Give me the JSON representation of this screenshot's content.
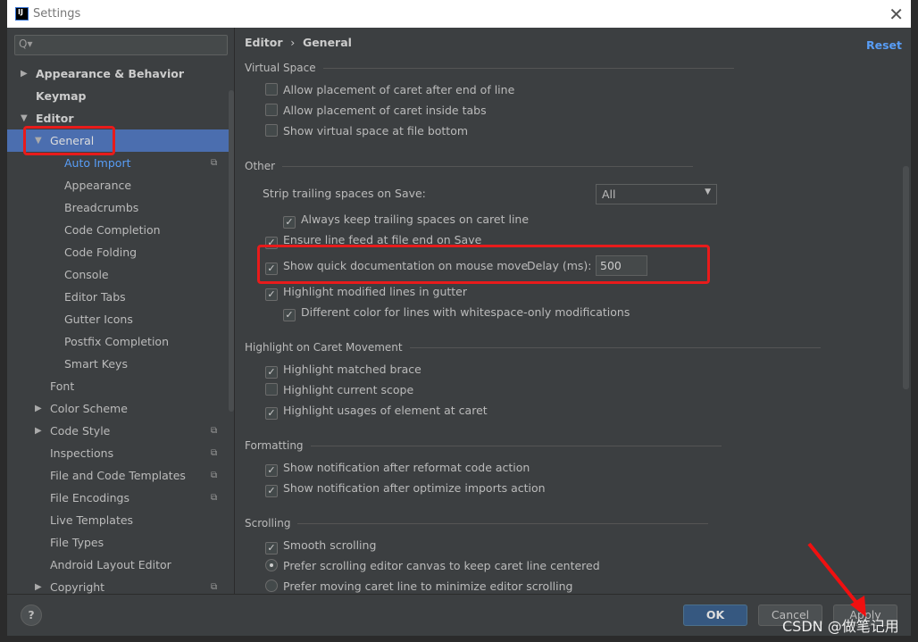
{
  "window": {
    "title": "Settings",
    "logo": "IJ",
    "close_icon": "close-icon"
  },
  "sidebar": {
    "search_placeholder": "Q▾",
    "items": [
      {
        "label": "Appearance & Behavior",
        "level": 0,
        "arrow": "▶",
        "bold": true
      },
      {
        "label": "Keymap",
        "level": 0,
        "arrow": "",
        "bold": true
      },
      {
        "label": "Editor",
        "level": 0,
        "arrow": "▼",
        "bold": true
      },
      {
        "label": "General",
        "level": 1,
        "arrow": "▼",
        "selected": true
      },
      {
        "label": "Auto Import",
        "level": 2,
        "blue": true,
        "copy": true
      },
      {
        "label": "Appearance",
        "level": 2
      },
      {
        "label": "Breadcrumbs",
        "level": 2
      },
      {
        "label": "Code Completion",
        "level": 2
      },
      {
        "label": "Code Folding",
        "level": 2
      },
      {
        "label": "Console",
        "level": 2
      },
      {
        "label": "Editor Tabs",
        "level": 2
      },
      {
        "label": "Gutter Icons",
        "level": 2
      },
      {
        "label": "Postfix Completion",
        "level": 2
      },
      {
        "label": "Smart Keys",
        "level": 2
      },
      {
        "label": "Font",
        "level": 1
      },
      {
        "label": "Color Scheme",
        "level": 1,
        "arrow": "▶"
      },
      {
        "label": "Code Style",
        "level": 1,
        "arrow": "▶",
        "copy": true
      },
      {
        "label": "Inspections",
        "level": 1,
        "copy": true
      },
      {
        "label": "File and Code Templates",
        "level": 1,
        "copy": true
      },
      {
        "label": "File Encodings",
        "level": 1,
        "copy": true
      },
      {
        "label": "Live Templates",
        "level": 1
      },
      {
        "label": "File Types",
        "level": 1
      },
      {
        "label": "Android Layout Editor",
        "level": 1
      },
      {
        "label": "Copyright",
        "level": 1,
        "arrow": "▶",
        "copy": true
      }
    ]
  },
  "main": {
    "breadcrumb": [
      "Editor",
      "›",
      "General"
    ],
    "reset_label": "Reset",
    "sections": {
      "virtual_space": "Virtual Space",
      "other": "Other",
      "caret": "Highlight on Caret Movement",
      "formatting": "Formatting",
      "scrolling": "Scrolling"
    },
    "options": {
      "vs1": {
        "label": "Allow placement of caret after end of line",
        "checked": false
      },
      "vs2": {
        "label": "Allow placement of caret inside tabs",
        "checked": false
      },
      "vs3": {
        "label": "Show virtual space at file bottom",
        "checked": false
      },
      "strip_label": "Strip trailing spaces on Save:",
      "strip_value": "All",
      "o1": {
        "label": "Always keep trailing spaces on caret line",
        "checked": true
      },
      "o2": {
        "label": "Ensure line feed at file end on Save",
        "checked": true
      },
      "o3": {
        "label": "Show quick documentation on mouse move",
        "checked": true
      },
      "delay_label": "Delay (ms):",
      "delay_value": "500",
      "o4": {
        "label": "Highlight modified lines in gutter",
        "checked": true
      },
      "o5": {
        "label": "Different color for lines with whitespace-only modifications",
        "checked": true
      },
      "c1": {
        "label": "Highlight matched brace",
        "checked": true
      },
      "c2": {
        "label": "Highlight current scope",
        "checked": false
      },
      "c3": {
        "label": "Highlight usages of element at caret",
        "checked": true
      },
      "f1": {
        "label": "Show notification after reformat code action",
        "checked": true
      },
      "f2": {
        "label": "Show notification after optimize imports action",
        "checked": true
      },
      "s1": {
        "label": "Smooth scrolling",
        "checked": true
      },
      "s2": {
        "label": "Prefer scrolling editor canvas to keep caret line centered",
        "selected": true
      },
      "s3": {
        "label": "Prefer moving caret line to minimize editor scrolling",
        "selected": false
      }
    }
  },
  "footer": {
    "help": "?",
    "ok": "OK",
    "cancel": "Cancel",
    "apply": "Apply"
  },
  "watermark": "CSDN @做笔记用",
  "colors": {
    "selection": "#4b6eaf",
    "link": "#589df6",
    "highlight": "#e81b1b",
    "background": "#3c3f41"
  }
}
